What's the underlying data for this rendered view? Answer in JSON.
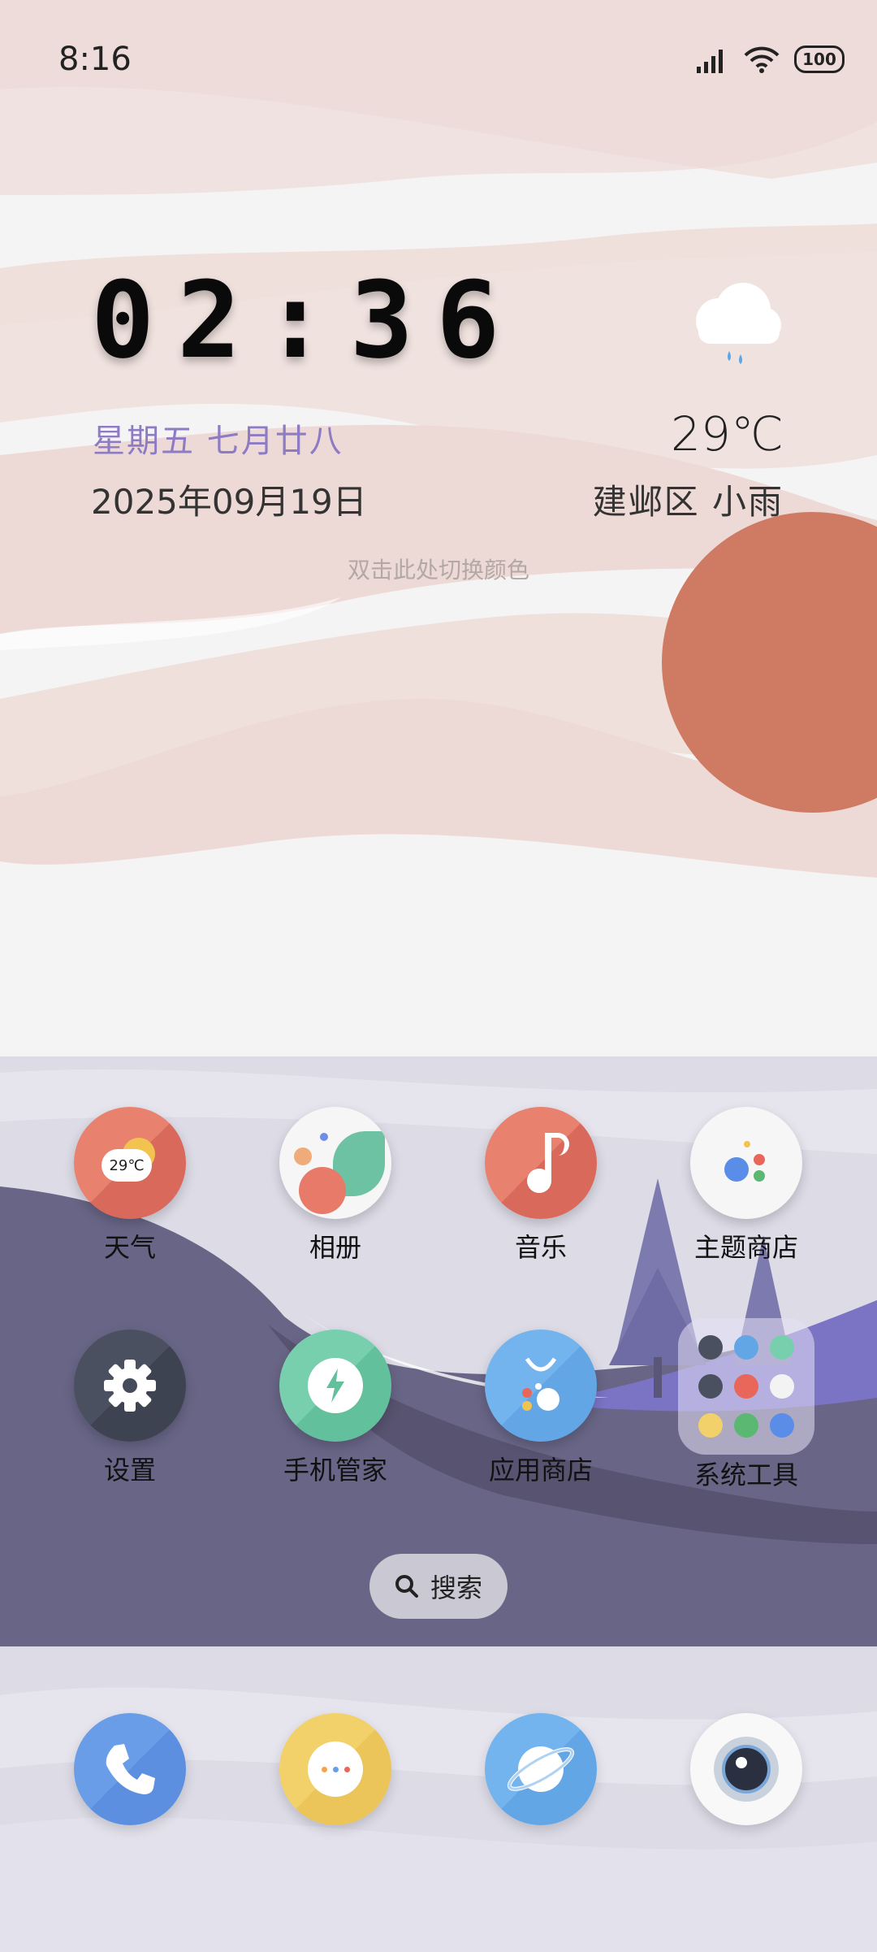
{
  "status_bar": {
    "time": "8:16",
    "battery": "100"
  },
  "clock_widget": {
    "time": "02:36",
    "lunar_date": "星期五  七月廿八",
    "date": "2025年09月19日",
    "temperature": "29℃",
    "location_weather": "建邺区  小雨",
    "hint": "双击此处切换颜色"
  },
  "apps": [
    {
      "label": "天气",
      "badge": "29℃"
    },
    {
      "label": "相册"
    },
    {
      "label": "音乐"
    },
    {
      "label": "主题商店"
    },
    {
      "label": "设置"
    },
    {
      "label": "手机管家"
    },
    {
      "label": "应用商店"
    },
    {
      "label": "系统工具"
    }
  ],
  "search": {
    "label": "搜索"
  },
  "dock": [
    "phone-icon",
    "messages-icon",
    "browser-icon",
    "camera-icon"
  ],
  "colors": {
    "accent": "#8d7bc4",
    "sun": "#cf7a62",
    "hills": "#686586"
  }
}
